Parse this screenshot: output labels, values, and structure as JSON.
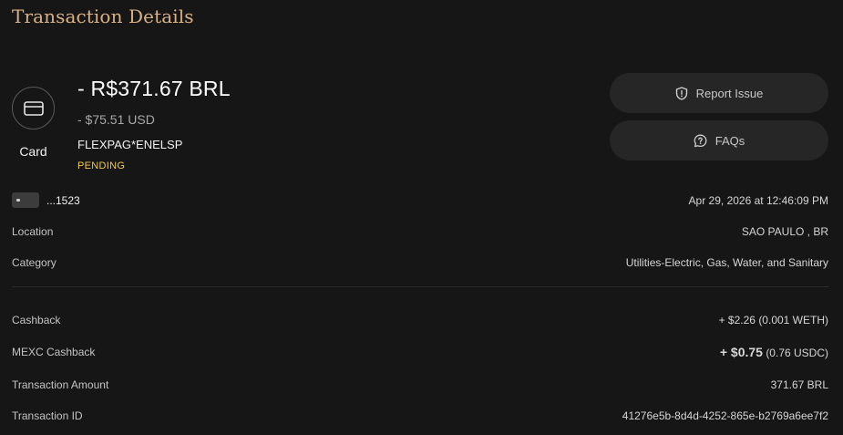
{
  "page": {
    "title": "Transaction Details"
  },
  "summary": {
    "card_label": "Card",
    "amount_primary": "- R$371.67 BRL",
    "amount_secondary": "- $75.51 USD",
    "merchant": "FLEXPAG*ENELSP",
    "status": "PENDING"
  },
  "actions": {
    "report_label": "Report Issue",
    "faq_label": "FAQs"
  },
  "details": {
    "card_last4": "...1523",
    "datetime": "Apr 29, 2026 at 12:46:09 PM",
    "location_label": "Location",
    "location_value": "SAO PAULO , BR",
    "category_label": "Category",
    "category_value": "Utilities-Electric, Gas, Water, and Sanitary"
  },
  "rewards": {
    "cashback_label": "Cashback",
    "cashback_value": "+ $2.26",
    "cashback_sub": "(0.001 WETH)",
    "mexc_label": "MEXC Cashback",
    "mexc_value": "+ $0.75",
    "mexc_sub": "(0.76 USDC)",
    "amount_label": "Transaction Amount",
    "amount_value": "371.67 BRL",
    "id_label": "Transaction ID",
    "id_value": "41276e5b-8d4d-4252-865e-b2769a6ee7f2"
  },
  "colors": {
    "title": "#d9b184",
    "status_pending": "#f0c94a",
    "cashback_green": "#3ddc84",
    "button_bg": "#262626",
    "background": "#161616"
  }
}
